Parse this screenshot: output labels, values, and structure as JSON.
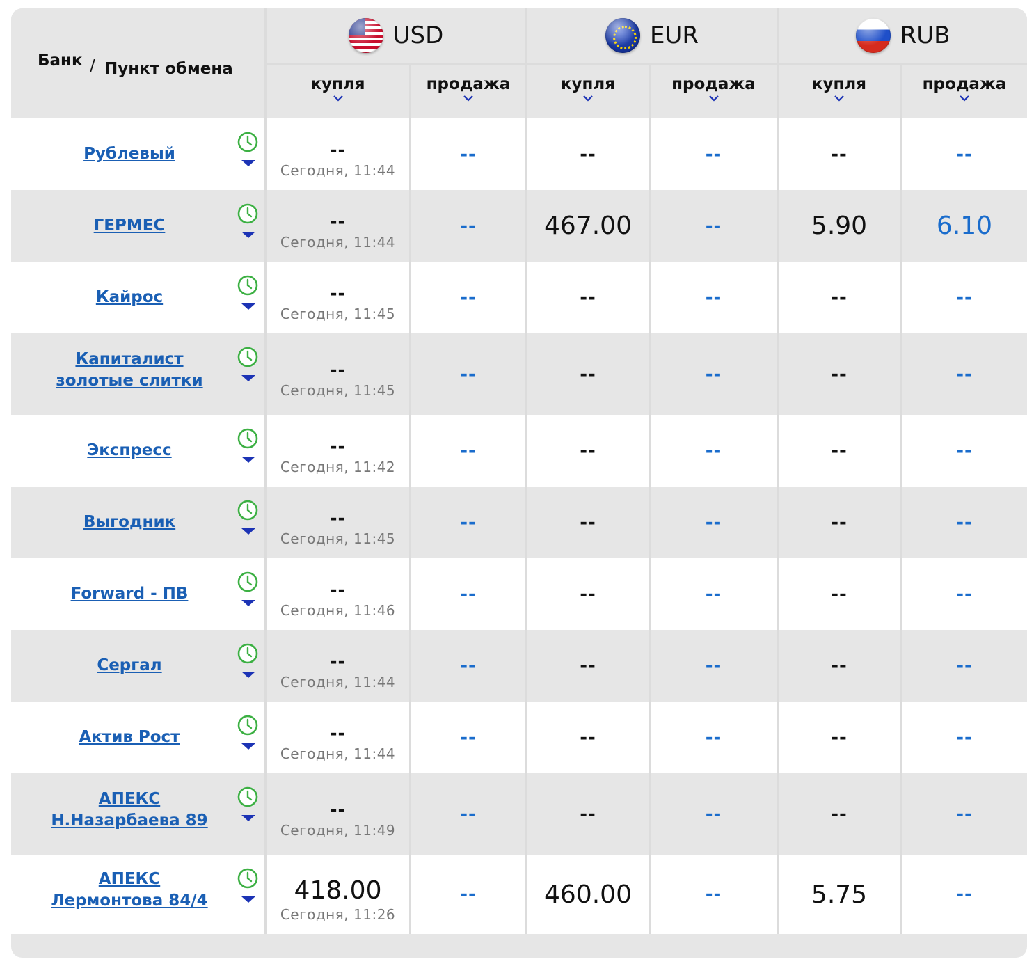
{
  "header": {
    "bank_label": "Банк",
    "slash": "/",
    "point_label": "Пункт обмена",
    "currencies": [
      {
        "code": "USD",
        "flag_icon": "us-flag-icon"
      },
      {
        "code": "EUR",
        "flag_icon": "eu-flag-icon"
      },
      {
        "code": "RUB",
        "flag_icon": "ru-flag-icon"
      }
    ],
    "buy_label": "купля",
    "sell_label": "продажа"
  },
  "colors": {
    "link": "#1a5fb4",
    "sell": "#1a6ccc",
    "clock": "#3cb043",
    "arrow": "#1c33b5"
  },
  "rows": [
    {
      "name": [
        "Рублевый"
      ],
      "updated": "Сегодня, 11:44",
      "usd_buy": "--",
      "usd_sell": "--",
      "eur_buy": "--",
      "eur_sell": "--",
      "rub_buy": "--",
      "rub_sell": "--"
    },
    {
      "name": [
        "ГЕРМЕС"
      ],
      "updated": "Сегодня, 11:44",
      "usd_buy": "--",
      "usd_sell": "--",
      "eur_buy": "467.00",
      "eur_sell": "--",
      "rub_buy": "5.90",
      "rub_sell": "6.10"
    },
    {
      "name": [
        "Кайрос"
      ],
      "updated": "Сегодня, 11:45",
      "usd_buy": "--",
      "usd_sell": "--",
      "eur_buy": "--",
      "eur_sell": "--",
      "rub_buy": "--",
      "rub_sell": "--"
    },
    {
      "name": [
        "Капиталист",
        "золотые слитки"
      ],
      "updated": "Сегодня, 11:45",
      "usd_buy": "--",
      "usd_sell": "--",
      "eur_buy": "--",
      "eur_sell": "--",
      "rub_buy": "--",
      "rub_sell": "--"
    },
    {
      "name": [
        "Экспресс"
      ],
      "updated": "Сегодня, 11:42",
      "usd_buy": "--",
      "usd_sell": "--",
      "eur_buy": "--",
      "eur_sell": "--",
      "rub_buy": "--",
      "rub_sell": "--"
    },
    {
      "name": [
        "Выгодник"
      ],
      "updated": "Сегодня, 11:45",
      "usd_buy": "--",
      "usd_sell": "--",
      "eur_buy": "--",
      "eur_sell": "--",
      "rub_buy": "--",
      "rub_sell": "--"
    },
    {
      "name": [
        "Forward - ПВ"
      ],
      "updated": "Сегодня, 11:46",
      "usd_buy": "--",
      "usd_sell": "--",
      "eur_buy": "--",
      "eur_sell": "--",
      "rub_buy": "--",
      "rub_sell": "--"
    },
    {
      "name": [
        "Сергал"
      ],
      "updated": "Сегодня, 11:44",
      "usd_buy": "--",
      "usd_sell": "--",
      "eur_buy": "--",
      "eur_sell": "--",
      "rub_buy": "--",
      "rub_sell": "--"
    },
    {
      "name": [
        "Актив Рост"
      ],
      "updated": "Сегодня, 11:44",
      "usd_buy": "--",
      "usd_sell": "--",
      "eur_buy": "--",
      "eur_sell": "--",
      "rub_buy": "--",
      "rub_sell": "--"
    },
    {
      "name": [
        "АПЕКС",
        "Н.Назарбаева 89"
      ],
      "updated": "Сегодня, 11:49",
      "usd_buy": "--",
      "usd_sell": "--",
      "eur_buy": "--",
      "eur_sell": "--",
      "rub_buy": "--",
      "rub_sell": "--"
    },
    {
      "name": [
        "АПЕКС",
        "Лермонтова 84/4"
      ],
      "updated": "Сегодня, 11:26",
      "usd_buy": "418.00",
      "usd_sell": "--",
      "eur_buy": "460.00",
      "eur_sell": "--",
      "rub_buy": "5.75",
      "rub_sell": "--"
    }
  ]
}
